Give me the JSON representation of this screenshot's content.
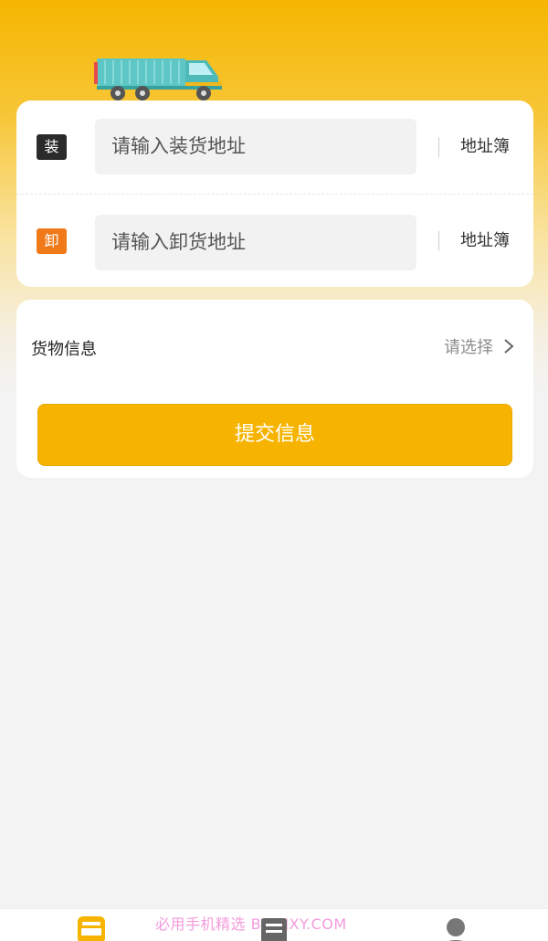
{
  "load": {
    "tag": "装",
    "placeholder": "请输入装货地址",
    "address_book": "地址簿"
  },
  "unload": {
    "tag": "卸",
    "placeholder": "请输入卸货地址",
    "address_book": "地址簿"
  },
  "goods": {
    "label": "货物信息",
    "select_text": "请选择"
  },
  "submit_label": "提交信息",
  "watermark": "必用手机精选 BYJSJXY.COM",
  "colors": {
    "accent": "#f6b400",
    "load_tag": "#2b2b2b",
    "unload_tag": "#f07a1a"
  },
  "icons": {
    "truck": "truck-illustration",
    "arrow": "chevron-right-icon",
    "tab1": "bus-icon",
    "tab2": "list-icon",
    "tab3": "user-icon"
  }
}
